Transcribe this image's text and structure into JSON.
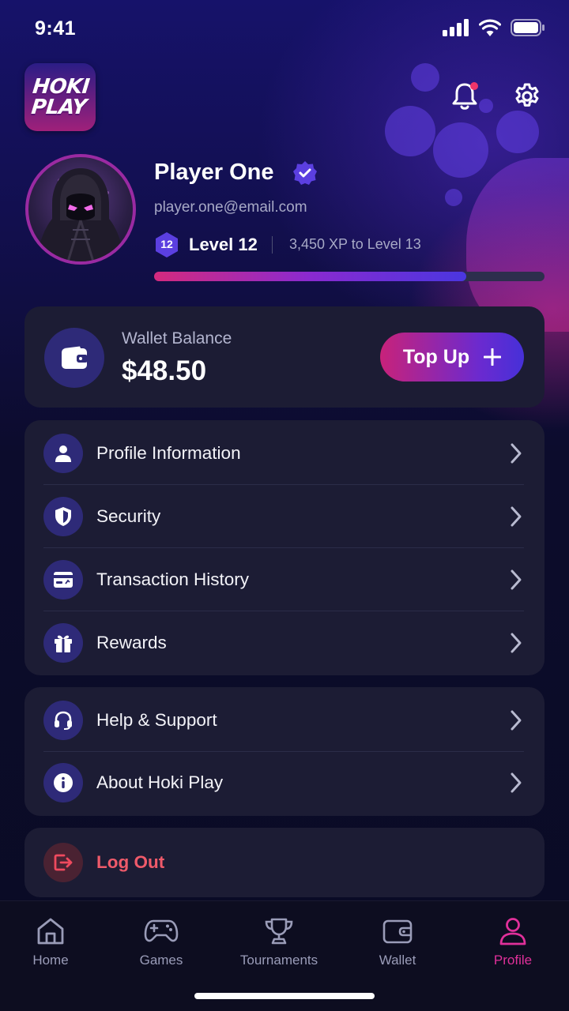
{
  "status_bar": {
    "time": "9:41"
  },
  "app": {
    "logo_text": "HOKI\nPLAY"
  },
  "profile": {
    "name": "Player One",
    "email": "player.one@email.com",
    "level_number": "12",
    "level_label": "Level 12",
    "xp_text": "3,450 XP to Level 13",
    "xp_progress_percent": 80
  },
  "wallet": {
    "label": "Wallet Balance",
    "amount": "$48.50",
    "top_up_label": "Top Up"
  },
  "menu_account": [
    {
      "label": "Profile Information",
      "icon": "user-icon"
    },
    {
      "label": "Security",
      "icon": "shield-icon"
    },
    {
      "label": "Transaction History",
      "icon": "card-icon"
    },
    {
      "label": "Rewards",
      "icon": "gift-icon"
    }
  ],
  "menu_support": [
    {
      "label": "Help & Support",
      "icon": "headset-icon"
    },
    {
      "label": "About Hoki Play",
      "icon": "info-icon"
    }
  ],
  "logout": {
    "label": "Log Out",
    "icon": "logout-icon"
  },
  "tabs": [
    {
      "label": "Home",
      "icon": "home-icon",
      "active": false
    },
    {
      "label": "Games",
      "icon": "gamepad-icon",
      "active": false
    },
    {
      "label": "Tournaments",
      "icon": "trophy-icon",
      "active": false
    },
    {
      "label": "Wallet",
      "icon": "wallet-icon",
      "active": false
    },
    {
      "label": "Profile",
      "icon": "profile-icon",
      "active": true
    }
  ],
  "colors": {
    "accent_pink": "#e0309a",
    "accent_purple": "#5b3fe0",
    "card_bg": "#1c1c34",
    "logout_red": "#ef5a6a"
  }
}
